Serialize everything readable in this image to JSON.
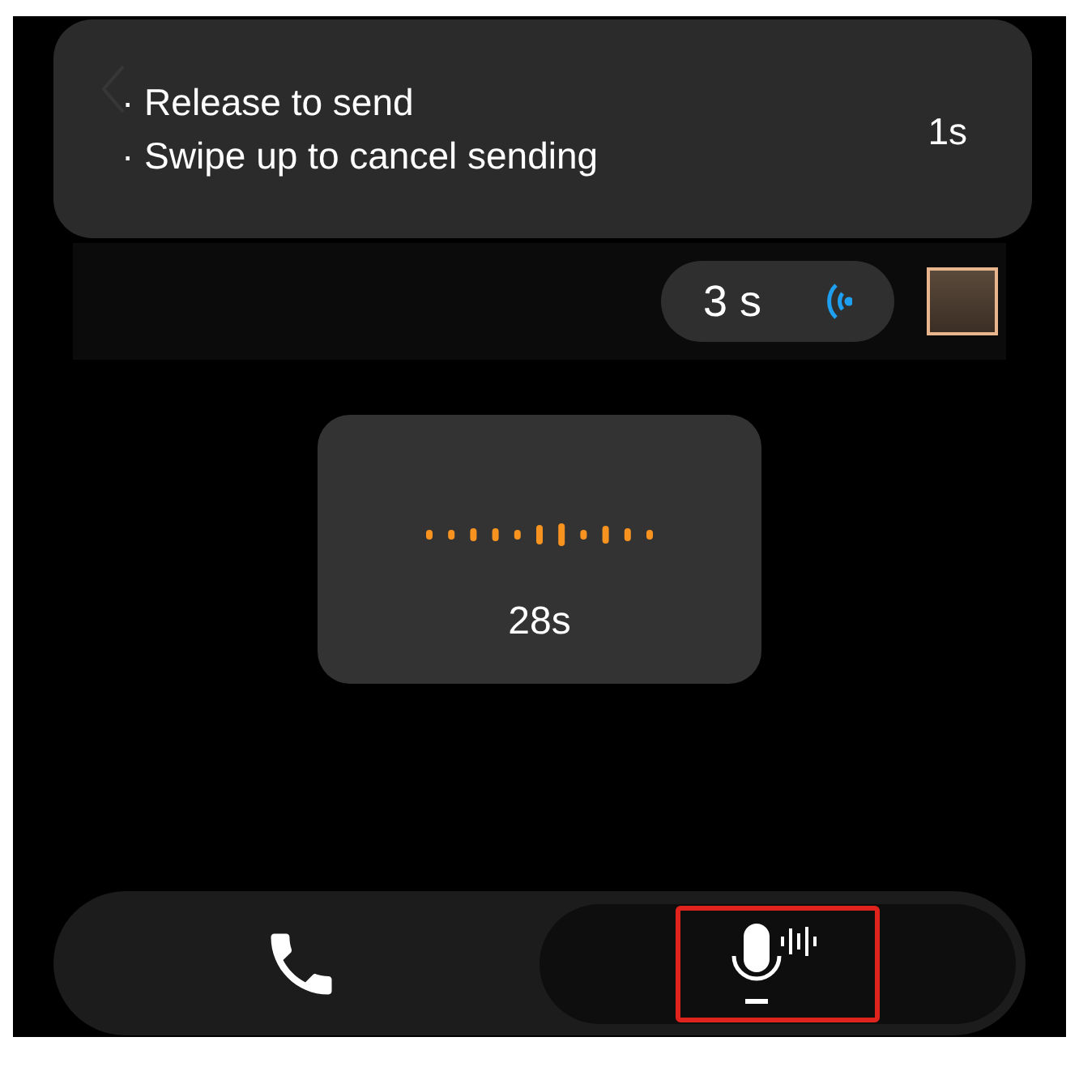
{
  "toast": {
    "lines": [
      "· Release to send",
      "· Swipe up to cancel sending"
    ],
    "duration": "1s"
  },
  "message": {
    "duration": "3 s"
  },
  "recording": {
    "elapsed": "28s"
  },
  "bottom_bar": {
    "buttons": [
      {
        "kind": "call",
        "selected": false
      },
      {
        "kind": "voice",
        "selected": true
      }
    ]
  }
}
